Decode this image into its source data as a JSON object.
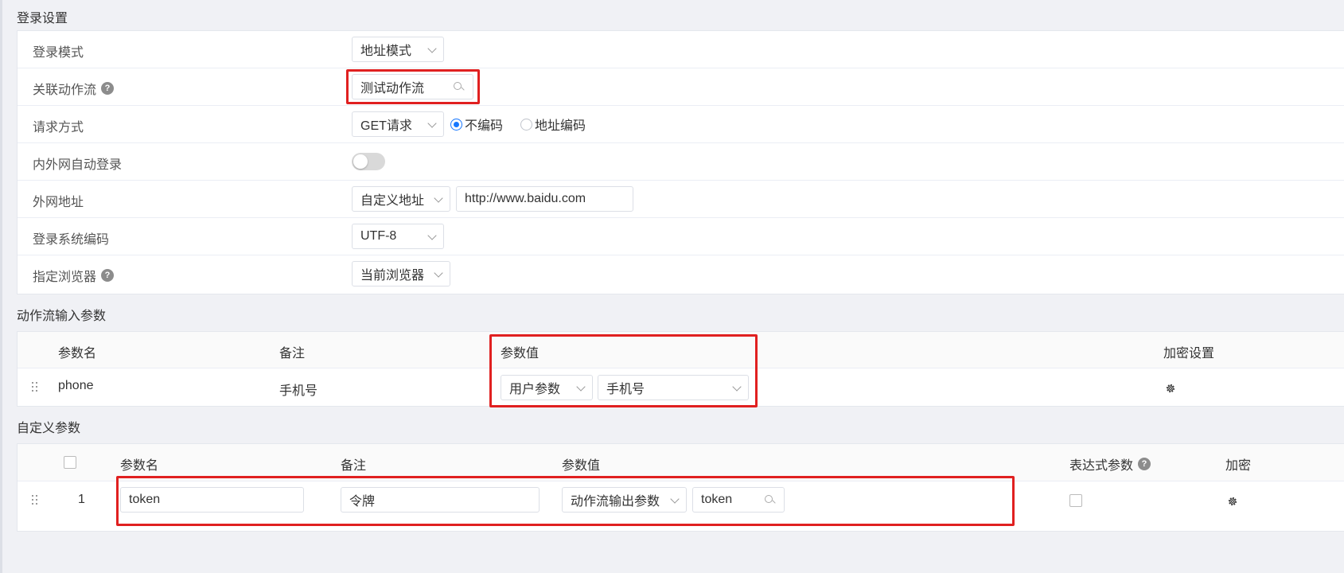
{
  "login_settings": {
    "title": "登录设置",
    "rows": {
      "login_mode": {
        "label": "登录模式",
        "value": "地址模式"
      },
      "linked_flow": {
        "label": "关联动作流",
        "help": "?",
        "value": "测试动作流"
      },
      "request_method": {
        "label": "请求方式",
        "value": "GET请求",
        "radio_options": [
          "不编码",
          "地址编码"
        ],
        "radio_selected": "不编码"
      },
      "auto_login": {
        "label": "内外网自动登录",
        "enabled": false
      },
      "external_address": {
        "label": "外网地址",
        "type_value": "自定义地址",
        "url_value": "http://www.baidu.com"
      },
      "encoding": {
        "label": "登录系统编码",
        "value": "UTF-8"
      },
      "browser": {
        "label": "指定浏览器",
        "help": "?",
        "value": "当前浏览器"
      }
    }
  },
  "flow_input_params": {
    "title": "动作流输入参数",
    "columns": [
      "参数名",
      "备注",
      "参数值",
      "加密设置"
    ],
    "rows": [
      {
        "name": "phone",
        "remark": "手机号",
        "value_type": "用户参数",
        "value": "手机号"
      }
    ]
  },
  "custom_params": {
    "title": "自定义参数",
    "columns": [
      "参数名",
      "备注",
      "参数值",
      "表达式参数",
      "加密"
    ],
    "rows": [
      {
        "index": "1",
        "name": "token",
        "remark": "令牌",
        "value_type": "动作流输出参数",
        "value": "token",
        "expression": false
      }
    ]
  },
  "colors": {
    "highlight": "#e02020",
    "accent": "#1677ff"
  },
  "icons": [
    "help-icon",
    "chevron-down-icon",
    "search-icon",
    "drag-handle-icon",
    "gear-icon"
  ]
}
